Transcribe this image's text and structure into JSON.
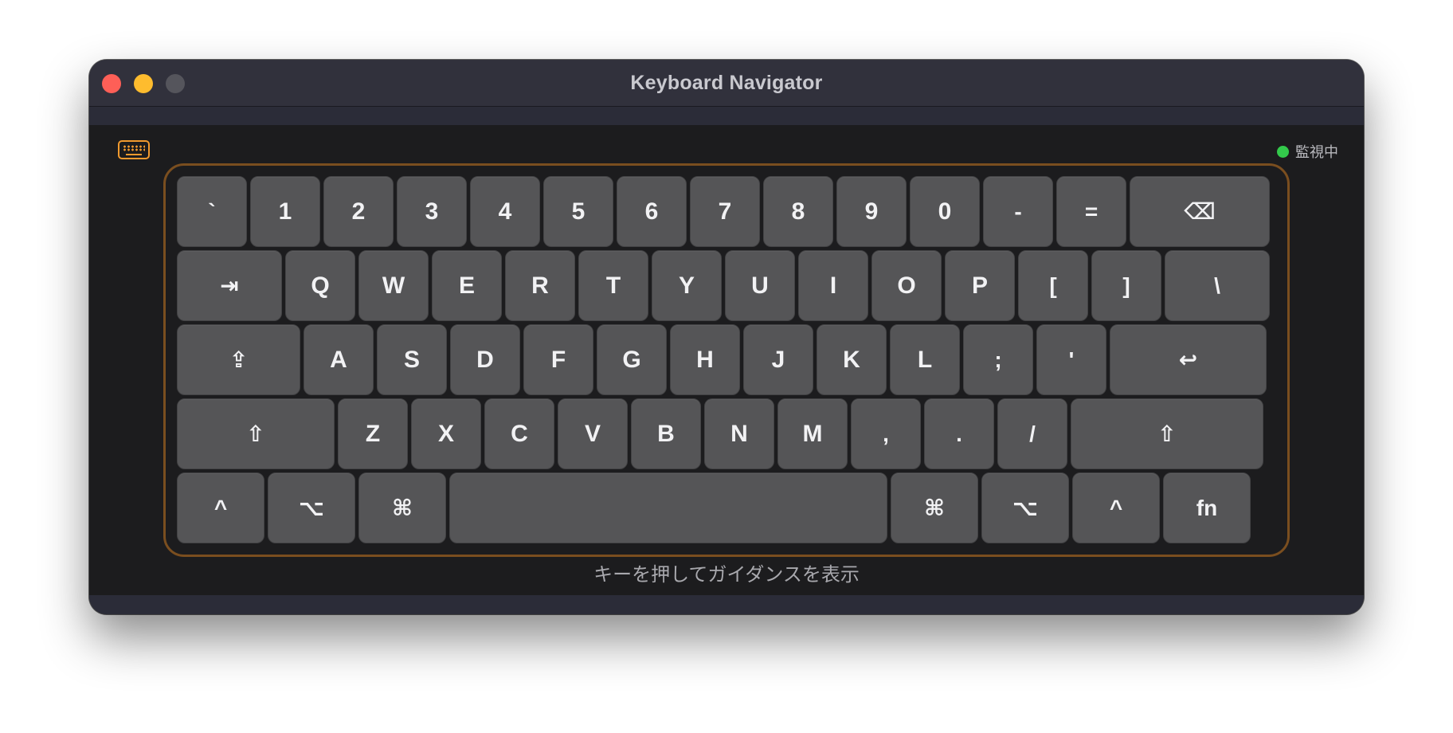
{
  "window": {
    "title": "Keyboard Navigator"
  },
  "status": {
    "label": "監視中",
    "color": "#33c94b"
  },
  "toolbar": {
    "icon": "keyboard-icon",
    "accent": "#f29a2e"
  },
  "keyboard": {
    "rows": [
      [
        {
          "label": "`",
          "w": 88
        },
        {
          "label": "1",
          "w": 88
        },
        {
          "label": "2",
          "w": 88
        },
        {
          "label": "3",
          "w": 88
        },
        {
          "label": "4",
          "w": 88
        },
        {
          "label": "5",
          "w": 88
        },
        {
          "label": "6",
          "w": 88
        },
        {
          "label": "7",
          "w": 88
        },
        {
          "label": "8",
          "w": 88
        },
        {
          "label": "9",
          "w": 88
        },
        {
          "label": "0",
          "w": 88
        },
        {
          "label": "-",
          "w": 88
        },
        {
          "label": "=",
          "w": 88
        },
        {
          "label": "⌫",
          "w": 176,
          "name": "delete"
        }
      ],
      [
        {
          "label": "⇥",
          "w": 132,
          "name": "tab"
        },
        {
          "label": "Q",
          "w": 88
        },
        {
          "label": "W",
          "w": 88
        },
        {
          "label": "E",
          "w": 88
        },
        {
          "label": "R",
          "w": 88
        },
        {
          "label": "T",
          "w": 88
        },
        {
          "label": "Y",
          "w": 88
        },
        {
          "label": "U",
          "w": 88
        },
        {
          "label": "I",
          "w": 88
        },
        {
          "label": "O",
          "w": 88
        },
        {
          "label": "P",
          "w": 88
        },
        {
          "label": "[",
          "w": 88
        },
        {
          "label": "]",
          "w": 88
        },
        {
          "label": "\\",
          "w": 132,
          "name": "backslash"
        }
      ],
      [
        {
          "label": "⇪",
          "w": 155,
          "name": "caps-lock"
        },
        {
          "label": "A",
          "w": 88
        },
        {
          "label": "S",
          "w": 88
        },
        {
          "label": "D",
          "w": 88
        },
        {
          "label": "F",
          "w": 88
        },
        {
          "label": "G",
          "w": 88
        },
        {
          "label": "H",
          "w": 88
        },
        {
          "label": "J",
          "w": 88
        },
        {
          "label": "K",
          "w": 88
        },
        {
          "label": "L",
          "w": 88
        },
        {
          "label": ";",
          "w": 88
        },
        {
          "label": "'",
          "w": 88
        },
        {
          "label": "↩",
          "w": 197,
          "name": "return"
        }
      ],
      [
        {
          "label": "⇧",
          "w": 198,
          "name": "left-shift"
        },
        {
          "label": "Z",
          "w": 88
        },
        {
          "label": "X",
          "w": 88
        },
        {
          "label": "C",
          "w": 88
        },
        {
          "label": "V",
          "w": 88
        },
        {
          "label": "B",
          "w": 88
        },
        {
          "label": "N",
          "w": 88
        },
        {
          "label": "M",
          "w": 88
        },
        {
          "label": ",",
          "w": 88
        },
        {
          "label": ".",
          "w": 88
        },
        {
          "label": "/",
          "w": 88
        },
        {
          "label": "⇧",
          "w": 242,
          "name": "right-shift"
        }
      ],
      [
        {
          "label": "^",
          "w": 110,
          "name": "left-control"
        },
        {
          "label": "⌥",
          "w": 110,
          "name": "left-option"
        },
        {
          "label": "⌘",
          "w": 110,
          "name": "left-command"
        },
        {
          "label": "",
          "w": 550,
          "name": "space"
        },
        {
          "label": "⌘",
          "w": 110,
          "name": "right-command"
        },
        {
          "label": "⌥",
          "w": 110,
          "name": "right-option"
        },
        {
          "label": "^",
          "w": 110,
          "name": "right-control"
        },
        {
          "label": "fn",
          "w": 110,
          "name": "fn"
        }
      ]
    ]
  },
  "hint": "キーを押してガイダンスを表示"
}
